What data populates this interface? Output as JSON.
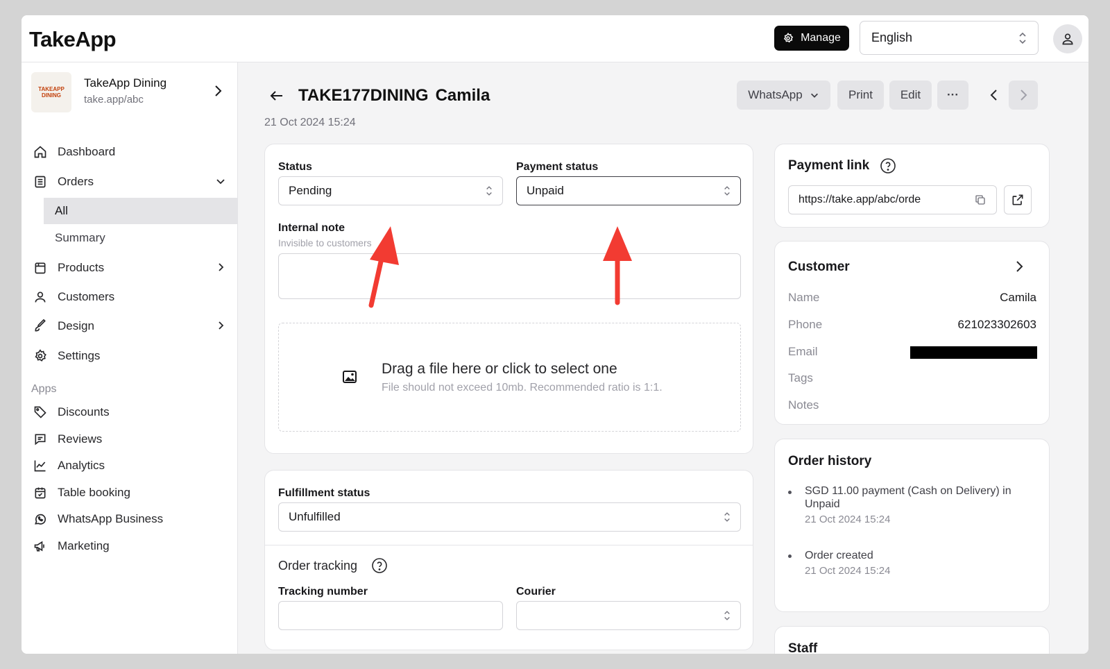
{
  "topbar": {
    "logo": "TakeApp",
    "manage_label": "Manage",
    "language": "English"
  },
  "store": {
    "name": "TakeApp Dining",
    "url": "take.app/abc",
    "logo_text": "TAKEAPP DINING"
  },
  "nav": {
    "dashboard": "Dashboard",
    "orders": "Orders",
    "orders_all": "All",
    "orders_summary": "Summary",
    "products": "Products",
    "customers": "Customers",
    "design": "Design",
    "settings": "Settings",
    "apps_label": "Apps",
    "discounts": "Discounts",
    "reviews": "Reviews",
    "analytics": "Analytics",
    "table_booking": "Table booking",
    "whatsapp_business": "WhatsApp Business",
    "marketing": "Marketing"
  },
  "order": {
    "id": "TAKE177DINING",
    "customer": "Camila",
    "date": "21 Oct 2024 15:24"
  },
  "actions": {
    "whatsapp": "WhatsApp",
    "print": "Print",
    "edit": "Edit",
    "more": "···"
  },
  "status_card": {
    "status_label": "Status",
    "status_value": "Pending",
    "payment_label": "Payment status",
    "payment_value": "Unpaid",
    "note_label": "Internal note",
    "note_hint": "Invisible to customers",
    "dz_title": "Drag a file here or click to select one",
    "dz_hint": "File should not exceed 10mb. Recommended ratio is 1:1."
  },
  "fulfillment_card": {
    "label": "Fulfillment status",
    "value": "Unfulfilled",
    "tracking_title": "Order tracking",
    "tracking_number_label": "Tracking number",
    "courier_label": "Courier"
  },
  "payment_link": {
    "title": "Payment link",
    "url": "https://take.app/abc/orde"
  },
  "customer": {
    "title": "Customer",
    "name_key": "Name",
    "name_val": "Camila",
    "phone_key": "Phone",
    "phone_val": "621023302603",
    "email_key": "Email",
    "tags_key": "Tags",
    "notes_key": "Notes"
  },
  "history": {
    "title": "Order history",
    "items": [
      {
        "text": "SGD 11.00 payment (Cash on Delivery) in Unpaid",
        "date": "21 Oct 2024 15:24"
      },
      {
        "text": "Order created",
        "date": "21 Oct 2024 15:24"
      }
    ]
  },
  "staff": {
    "title": "Staff"
  },
  "colors": {
    "arrow": "#f23b32",
    "primary": "#0a0a0a"
  }
}
